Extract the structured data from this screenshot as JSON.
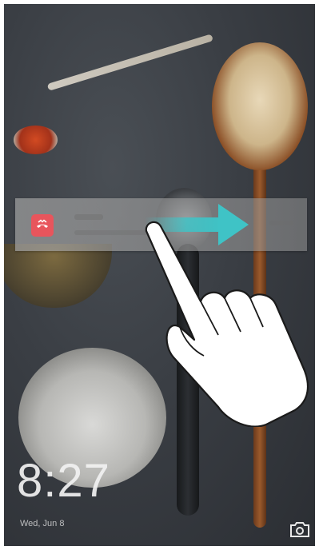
{
  "lock_screen": {
    "time": "8:27",
    "date": "Wed, Jun 8"
  },
  "notification": {
    "app_icon": "missed-call-icon",
    "accent_color": "#e8555c",
    "title": "",
    "body": ""
  },
  "gesture_hint": {
    "arrow_icon": "swipe-right-arrow-icon",
    "arrow_color": "#3fc3c6",
    "hand_icon": "pointing-hand-icon"
  },
  "shortcuts": {
    "camera_icon": "camera-icon"
  }
}
